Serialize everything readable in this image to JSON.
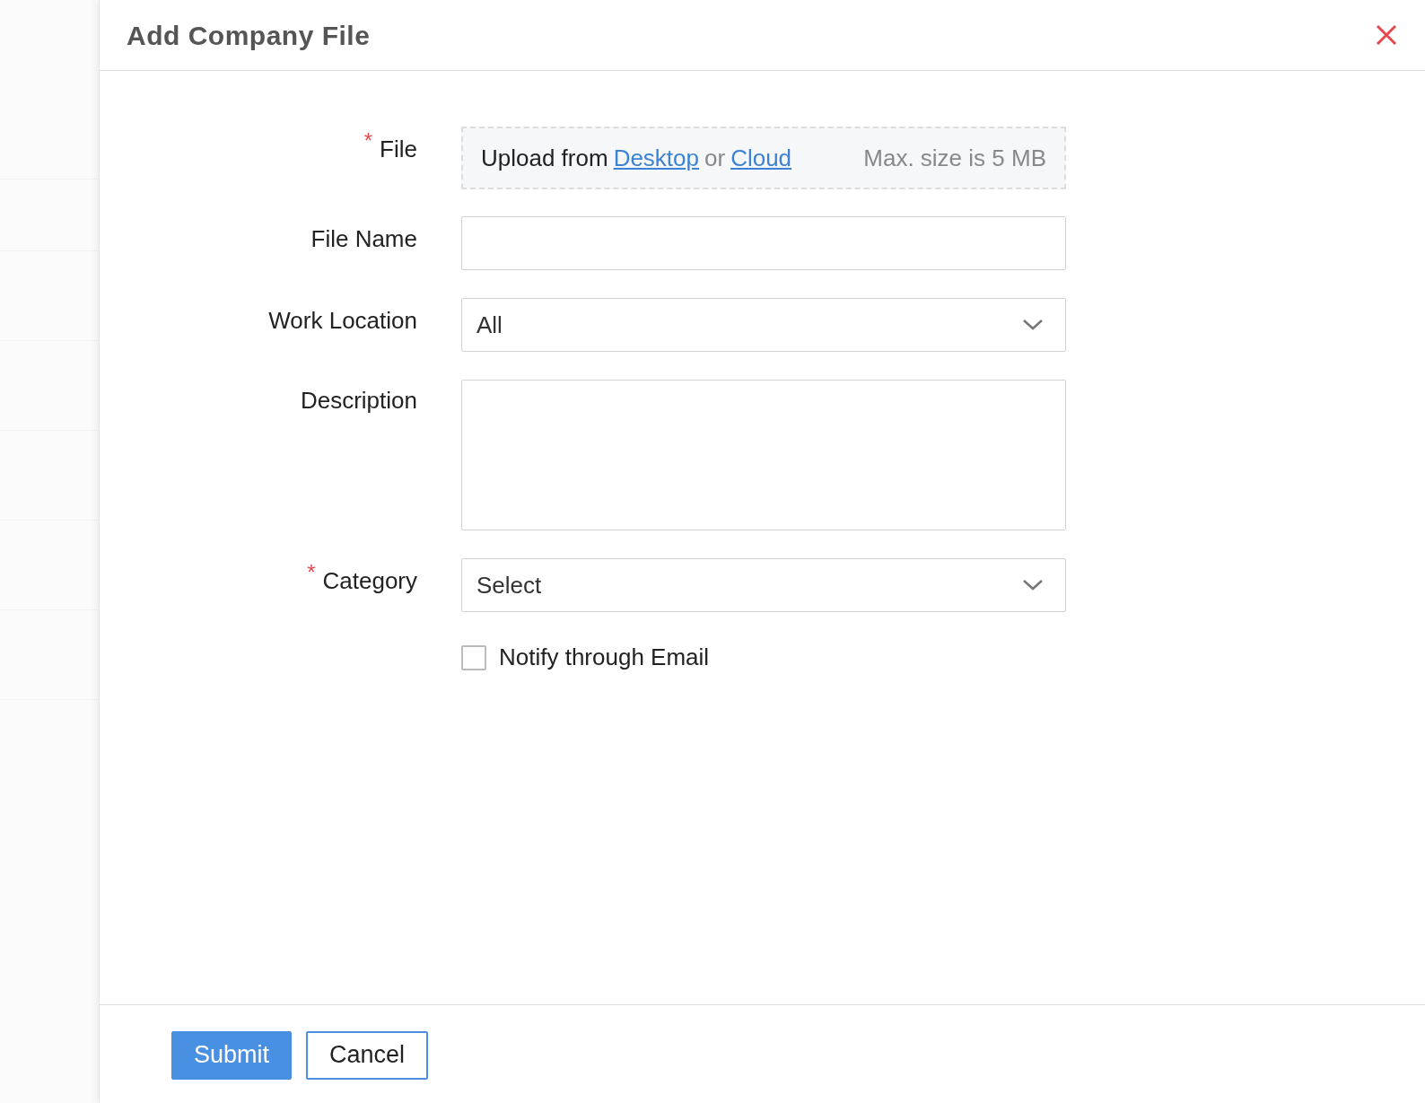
{
  "dialog": {
    "title": "Add Company File"
  },
  "fields": [
    {
      "kind": "upload",
      "label": "File",
      "required_mark": "*",
      "prefix": "Upload from",
      "link_1": "Desktop",
      "separator": "or",
      "link_2": "Cloud",
      "hint": "Max. size is 5 MB"
    },
    {
      "kind": "text",
      "label": "File Name"
    },
    {
      "kind": "select",
      "label": "Work Location",
      "value": "All"
    },
    {
      "kind": "textarea",
      "label": "Description"
    },
    {
      "kind": "select",
      "label": "Category",
      "required_mark": "*",
      "value": "Select"
    }
  ],
  "notify": {
    "label": "Notify through Email",
    "checked": false
  },
  "buttons": [
    {
      "label": "Submit",
      "kind": "primary"
    },
    {
      "label": "Cancel",
      "kind": "secondary"
    }
  ]
}
